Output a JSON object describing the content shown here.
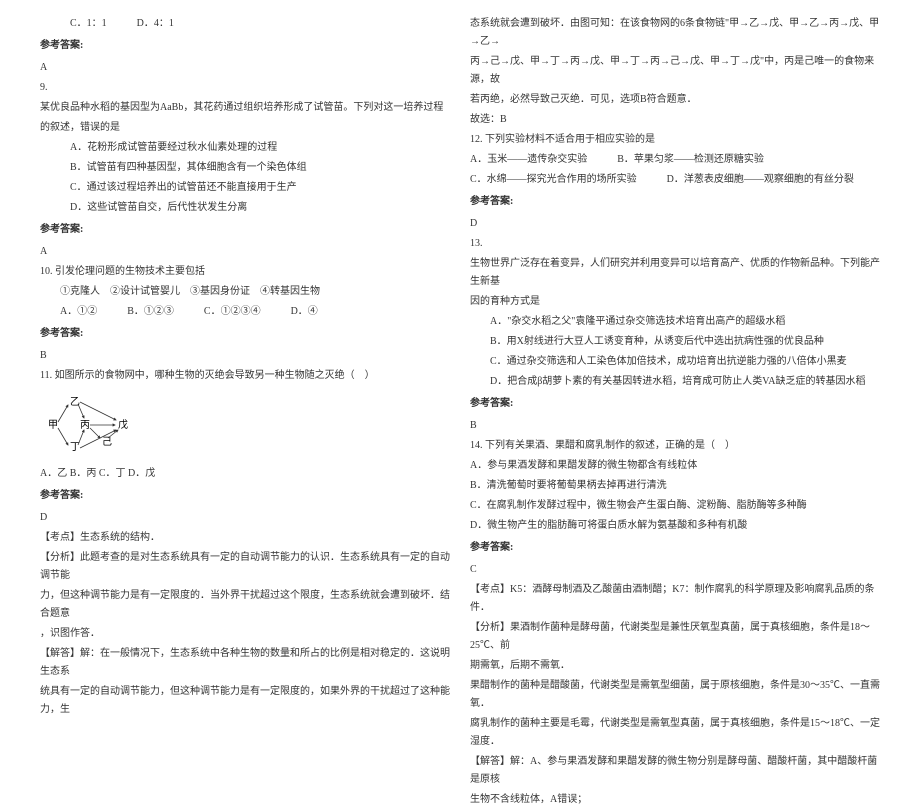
{
  "left": {
    "q8_opts": {
      "c": "C．1：1",
      "d": "D．4：1"
    },
    "q8_answer_label": "参考答案:",
    "q8_answer": "A",
    "q9_num": "9.",
    "q9_text1": "某优良品种水稻的基因型为AaBb，其花药通过组织培养形成了试管苗。下列对这一培养过程",
    "q9_text2": "的叙述，错误的是",
    "q9_a": "A．花粉形成试管苗要经过秋水仙素处理的过程",
    "q9_b": "B．试管苗有四种基因型，其体细胞含有一个染色体组",
    "q9_c": "C．通过该过程培养出的试管苗还不能直接用于生产",
    "q9_d": "D．这些试管苗自交，后代性状发生分离",
    "q9_answer_label": "参考答案:",
    "q9_answer": "A",
    "q10_text": "10. 引发伦理问题的生物技术主要包括",
    "q10_opts1": "①克隆人　②设计试管婴儿　③基因身份证　④转基因生物",
    "q10_a": "A．①②",
    "q10_b": "B．①②③",
    "q10_c": "C．①②③④",
    "q10_d": "D．④",
    "q10_answer_label": "参考答案:",
    "q10_answer": "B",
    "q11_text": "11. 如图所示的食物网中，哪种生物的灭绝会导致另一种生物随之灭绝（　）",
    "q11_opts": "A．乙 B．丙 C．丁 D．戊",
    "q11_answer_label": "参考答案:",
    "q11_answer": "D",
    "q11_kaodian": "【考点】生态系统的结构．",
    "q11_fenxi1": "【分析】此题考查的是对生态系统具有一定的自动调节能力的认识．生态系统具有一定的自动调节能",
    "q11_fenxi2": "力，但这种调节能力是有一定限度的．当外界干扰超过这个限度，生态系统就会遭到破坏．结合题意",
    "q11_fenxi3": "，识图作答．",
    "q11_jieda1": "【解答】解：在一般情况下，生态系统中各种生物的数量和所占的比例是相对稳定的．这说明生态系",
    "q11_jieda2": "统具有一定的自动调节能力，但这种调节能力是有一定限度的，如果外界的干扰超过了这种能力，生",
    "diagram_labels": {
      "jia": "甲",
      "yi": "乙",
      "bing": "丙",
      "ding": "丁",
      "wu": "戊",
      "ji": "己"
    }
  },
  "right": {
    "q11_cont1": "态系统就会遭到破坏．由图可知：在该食物网的6条食物链\"甲→乙→戊、甲→乙→丙→戊、甲→乙→",
    "q11_cont2": "丙→己→戊、甲→丁→丙→戊、甲→丁→丙→己→戊、甲→丁→戊\"中，丙是己唯一的食物来源，故",
    "q11_cont3": "若丙绝，必然导致己灭绝．可见，选项B符合题意．",
    "q11_cont4": "故选：B",
    "q12_text": "12. 下列实验材料不适合用于相应实验的是",
    "q12_a": "A．玉米——遗传杂交实验",
    "q12_b": "B．苹果匀浆——检测还原糖实验",
    "q12_c": "C．水绵——探究光合作用的场所实验",
    "q12_d": "D．洋葱表皮细胞——观察细胞的有丝分裂",
    "q12_answer_label": "参考答案:",
    "q12_answer": "D",
    "q13_num": "13.",
    "q13_text1": "生物世界广泛存在着变异，人们研究并利用变异可以培育高产、优质的作物新品种。下列能产生新基",
    "q13_text2": "因的育种方式是",
    "q13_a": "A．\"杂交水稻之父\"袁隆平通过杂交筛选技术培育出高产的超级水稻",
    "q13_b": "B．用X射线进行大豆人工诱变育种，从诱变后代中选出抗病性强的优良品种",
    "q13_c": "C．通过杂交筛选和人工染色体加倍技术，成功培育出抗逆能力强的八倍体小黑麦",
    "q13_d": "D．把合成β胡萝卜素的有关基因转进水稻，培育成可防止人类VA缺乏症的转基因水稻",
    "q13_answer_label": "参考答案:",
    "q13_answer": "B",
    "q14_text": "14. 下列有关果酒、果醋和腐乳制作的叙述，正确的是（　）",
    "q14_a": "A．参与果酒发酵和果醋发酵的微生物都含有线粒体",
    "q14_b": "B．清洗葡萄时要将葡萄果柄去掉再进行清洗",
    "q14_c": "C．在腐乳制作发酵过程中，微生物会产生蛋白酶、淀粉酶、脂肪酶等多种酶",
    "q14_d": "D．微生物产生的脂肪酶可将蛋白质水解为氨基酸和多种有机酸",
    "q14_answer_label": "参考答案:",
    "q14_answer": "C",
    "q14_kaodian": "【考点】K5：酒酵母制酒及乙酸菌由酒制醋；K7：制作腐乳的科学原理及影响腐乳品质的条件．",
    "q14_fenxi1": "【分析】果酒制作菌种是酵母菌，代谢类型是兼性厌氧型真菌，属于真核细胞，条件是18～25℃、前",
    "q14_fenxi2": "期需氧，后期不需氧．",
    "q14_fenxi3": "果醋制作的菌种是醋酸菌，代谢类型是需氧型细菌，属于原核细胞，条件是30～35℃、一直需氧．",
    "q14_fenxi4": "腐乳制作的菌种主要是毛霉，代谢类型是需氧型真菌，属于真核细胞，条件是15～18℃、一定湿度．",
    "q14_jieda1": "【解答】解：A、参与果酒发酵和果醋发酵的微生物分别是酵母菌、醋酸杆菌，其中醋酸杆菌是原核",
    "q14_jieda2": "生物不含线粒体，A错误；"
  }
}
